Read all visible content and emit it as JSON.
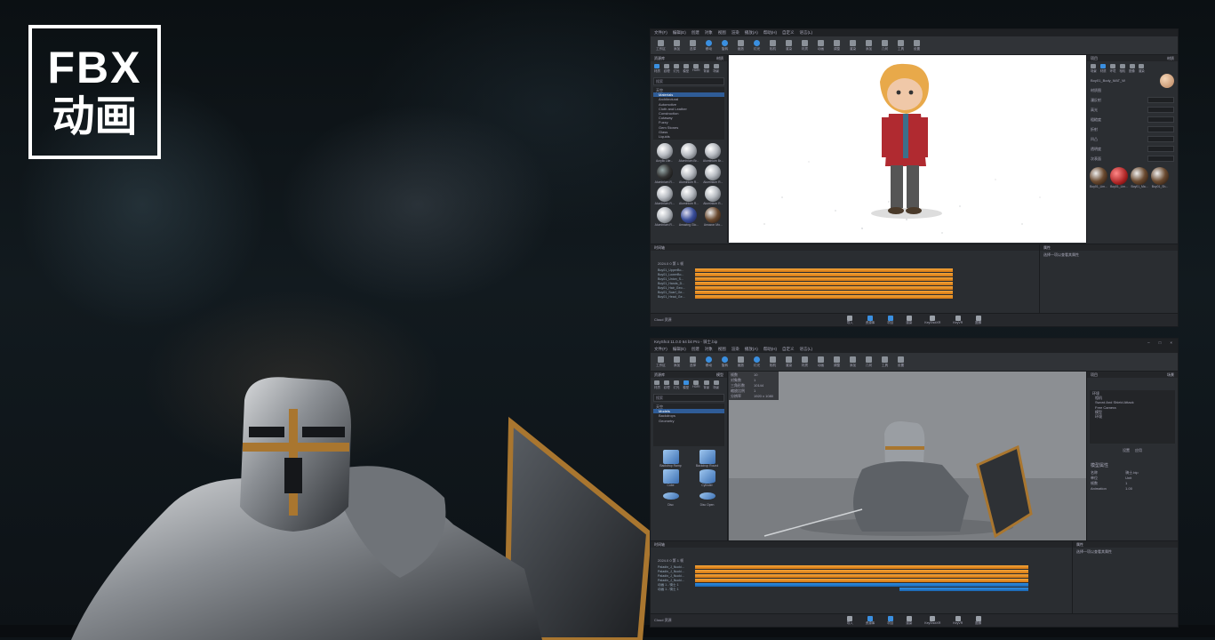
{
  "badge": {
    "line1": "FBX",
    "line2": "动画"
  },
  "window_top": {
    "menu": [
      "文件(F)",
      "编辑(E)",
      "创建",
      "对象",
      "视图",
      "渲染",
      "播放(A)",
      "帮助(H)",
      "自定义",
      "语言(L)"
    ],
    "toolbar": [
      "工作区",
      "添加",
      "选择",
      "移动",
      "旋转",
      "缩放",
      "灯光",
      "相机",
      "渲染",
      "材质",
      "动画",
      "调整",
      "渲染",
      "添加",
      "几何",
      "工具",
      "设置"
    ],
    "left_panel": {
      "title": "资源库",
      "tab": "材质",
      "icons": [
        "材质",
        "纹理",
        "灯光",
        "模型",
        "HDRI",
        "背景",
        "场景"
      ],
      "search": "搜索",
      "tree": [
        "天空",
        "Materials",
        "Architectural",
        "Automotive",
        "Cloth and Leather",
        "Construction",
        "Cutaway",
        "Fuzzy",
        "Gem Stones",
        "Glass",
        "Liquids"
      ],
      "materials": [
        "Acrylic Lite...",
        "Aluminium Br...",
        "Aluminium Br...",
        "Aluminium R...",
        "Aluminium R...",
        "Aluminium R...",
        "Aluminium R...",
        "Aluminium R...",
        "Aluminium R...",
        "Aluminium R...",
        "Amazing Glo...",
        "Amazon Mo..."
      ]
    },
    "right_panel": {
      "title": "项目",
      "tab": "材质",
      "icons": [
        "场景",
        "材质",
        "环境",
        "相机",
        "图像",
        "渲染"
      ],
      "material_name": "Boy01_Body_MAT_W",
      "type_label": "材质图",
      "rows": [
        "漫反射",
        "高光",
        "粗糙度",
        "折射",
        "凹凸",
        "透明度",
        "次表面"
      ],
      "swatches": [
        "Boy01_Lim...",
        "Boy01_Lim...",
        "Boy01_Ma...",
        "Boy01_Sh..."
      ]
    },
    "timeline": {
      "title": "时间轴",
      "tracks": [
        "Boy01_UpperBo...",
        "Boy01_LowerBo...",
        "Boy01_Union_S...",
        "Boy01_Hands_D...",
        "Boy01_Hair_Geo...",
        "Boy01_Scarf_Ge...",
        "Boy01_Head_Ge..."
      ],
      "timecode": "2024.0 0 第 1 帧"
    },
    "right_timeline": {
      "title": "属性",
      "text": "选择一项以查看其属性"
    },
    "status": [
      "导入",
      "资源库",
      "项目",
      "渲染",
      "KeyShotXR",
      "KeyVR",
      "图像"
    ],
    "status_left": "Cloud 资源"
  },
  "window_bottom": {
    "title": "KeyShot 11.0.0 64 bit Pro - 骑士.bip",
    "menu": [
      "文件(F)",
      "编辑(E)",
      "创建",
      "对象",
      "视图",
      "渲染",
      "播放(A)",
      "帮助(H)",
      "自定义",
      "语言(L)"
    ],
    "toolbar": [
      "工作区",
      "添加",
      "选择",
      "移动",
      "旋转",
      "缩放",
      "灯光",
      "相机",
      "渲染",
      "材质",
      "动画",
      "调整",
      "添加",
      "几何",
      "工具",
      "设置"
    ],
    "left_panel": {
      "title": "资源库",
      "tab": "模型",
      "icons": [
        "材质",
        "纹理",
        "灯光",
        "模型",
        "HDRI",
        "背景",
        "场景"
      ],
      "search": "搜索",
      "tree": [
        "天空",
        "Models",
        "Backdrops",
        "Geometry"
      ],
      "models": [
        "Backdrop Ramp",
        "Backdrop Round",
        "Cube",
        "Cylinder",
        "Disc",
        "Disc Open"
      ]
    },
    "viewport_info": [
      "帧数",
      "10",
      "对象数",
      "1",
      "三角形数",
      "10144",
      "缩放比例",
      "1",
      "分辨率",
      "1920 x 1080"
    ],
    "right_panel": {
      "title": "项目",
      "tab": "场景",
      "tree": [
        "环境",
        "相机",
        "Sword And Shield Attack",
        "Free Camera",
        "模型",
        "环境"
      ],
      "section_title": "模型属性",
      "props": [
        "名称",
        "骑士.bip",
        "单位",
        "Unit",
        "帧数",
        "1",
        "Animation",
        "1.00"
      ],
      "buttons": [
        "设置",
        "应用"
      ]
    },
    "timeline": {
      "title": "时间轴",
      "tracks": [
        "Paladin_J_Nucki...",
        "Paladin_J_Nucki...",
        "Paladin_J_Nucki...",
        "Paladin_J_Nucki...",
        "动画 1 - 骑士 1",
        "动画 1 - 骑士 1"
      ],
      "timecode": "2024.0 0 第 1 帧"
    },
    "right_timeline": {
      "title": "属性",
      "text": "选择一项以查看其属性"
    },
    "status": [
      "导入",
      "资源库",
      "项目",
      "渲染",
      "KeyShotXR",
      "KeyVR",
      "图像"
    ],
    "status_left": "Cloud 资源"
  }
}
